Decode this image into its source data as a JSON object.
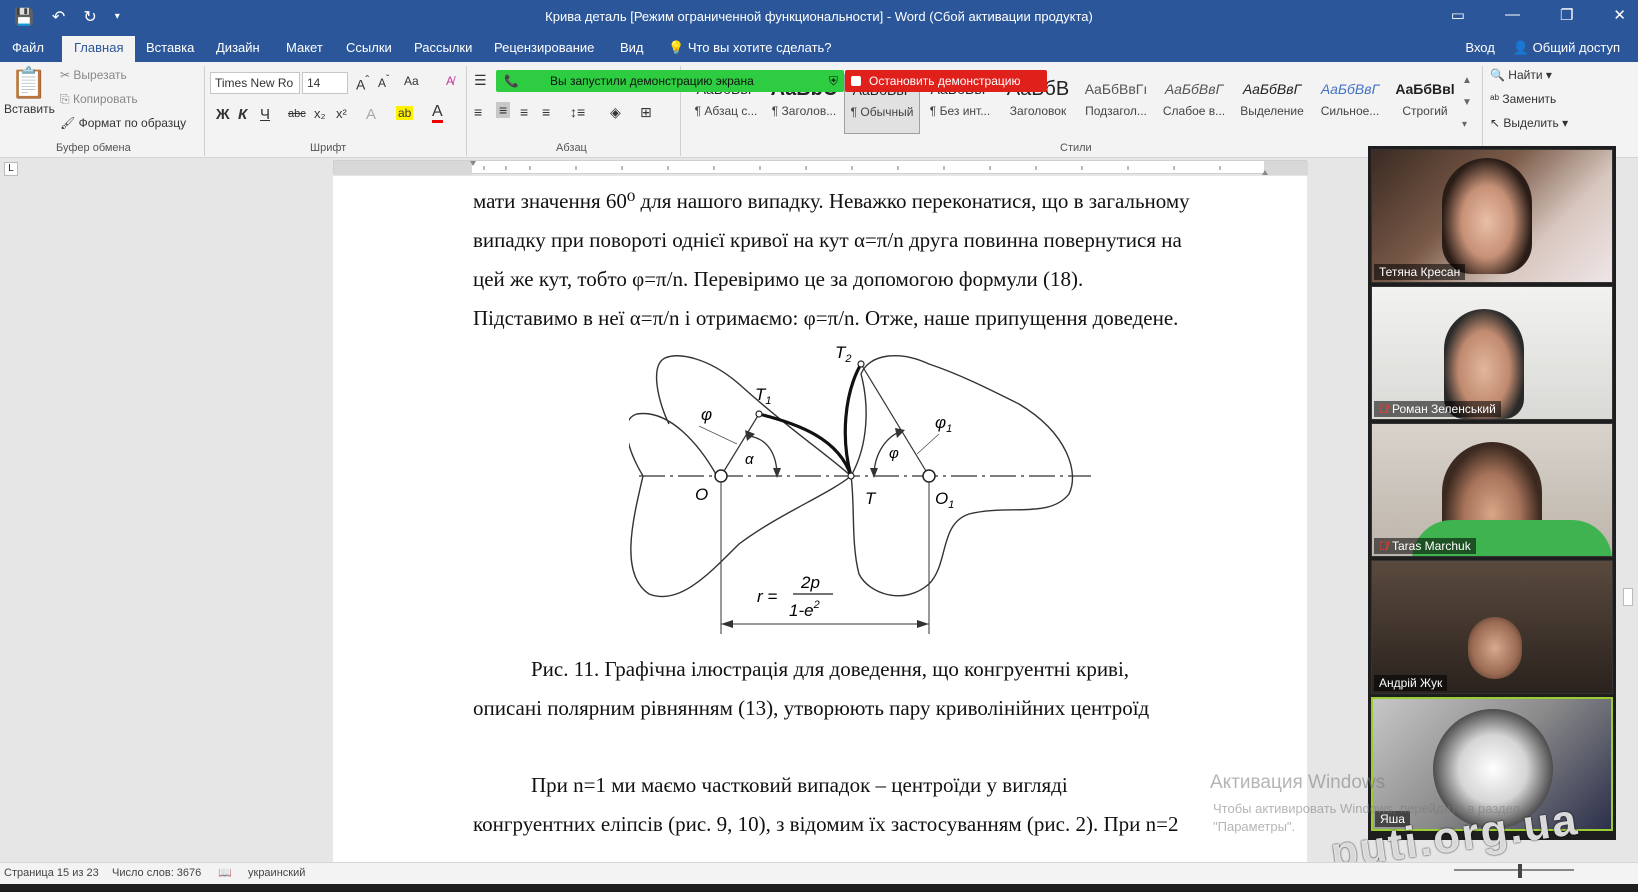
{
  "window": {
    "title": "Крива деталь [Режим ограниченной функциональности] - Word (Сбой активации продукта)"
  },
  "tabs": [
    "Файл",
    "Главная",
    "Вставка",
    "Дизайн",
    "Макет",
    "Ссылки",
    "Рассылки",
    "Рецензирование",
    "Вид"
  ],
  "tell_me": "Что вы хотите сделать?",
  "account": {
    "login": "Вход",
    "share": "Общий доступ"
  },
  "clipboard": {
    "paste": "Вставить",
    "cut": "Вырезать",
    "copy": "Копировать",
    "format_painter": "Формат по образцу",
    "group": "Буфер обмена"
  },
  "font": {
    "name": "Times New Ro",
    "size": "14",
    "group": "Шрифт",
    "bold": "Ж",
    "italic": "К",
    "underline": "Ч",
    "strike": "abc",
    "sub": "x₂",
    "sup": "x²",
    "aa": "Aa"
  },
  "paragraph": {
    "group": "Абзац"
  },
  "styles": {
    "group": "Стили",
    "items": [
      {
        "preview": "AaБбВвГ",
        "name": "¶ Абзац с..."
      },
      {
        "preview": "AaBbC",
        "name": "¶ Заголов..."
      },
      {
        "preview": "AaБбВвГ",
        "name": "¶ Обычный"
      },
      {
        "preview": "AaБбВвГ",
        "name": "¶ Без инт..."
      },
      {
        "preview": "AaБбВ",
        "name": "Заголовок"
      },
      {
        "preview": "AaБбВвГı",
        "name": "Подзагол..."
      },
      {
        "preview": "AaБбВвГ",
        "name": "Слабое в..."
      },
      {
        "preview": "AaБбВвГ",
        "name": "Выделение"
      },
      {
        "preview": "AaБбВвГ",
        "name": "Сильное..."
      },
      {
        "preview": "AaБбВвl",
        "name": "Строгий"
      }
    ]
  },
  "editing": {
    "find": "Найти",
    "replace": "Заменить",
    "select": "Выделить"
  },
  "screen_share": {
    "status": "Вы запустили демонстрацию экрана",
    "stop": "Остановить демонстрацию"
  },
  "document": {
    "lines": [
      "мати значення 60⁰ для нашого випадку. Неважко переконатися, що в загальному",
      "випадку при повороті однієї кривої на кут α=π/n друга повинна повернутися на",
      "цей же кут, тобто φ=π/n. Перевіримо це за допомогою формули (18).",
      "Підставимо в неї α=π/n і отримаємо: φ=π/n. Отже, наше припущення доведене."
    ],
    "figure_labels": {
      "T1": "T",
      "T1_sub": "1",
      "T2": "T",
      "T2_sub": "2",
      "phi": "φ",
      "phi1": "φ",
      "phi1_sub": "1",
      "alpha": "α",
      "phi_arc": "φ",
      "O": "O",
      "T": "T",
      "O1": "O",
      "O1_sub": "1",
      "r": "r =",
      "num": "2p",
      "den": "1-e",
      "den_sup": "2"
    },
    "caption_line1": "Рис. 11. Графічна ілюстрація для доведення, що конгруентні криві,",
    "caption_line2": "описані полярним рівнянням (13), утворюють пару криволінійних центроїд",
    "para2_line1": "При n=1 ми маємо частковий випадок – центроїди у вигляді",
    "para2_line2": "конгруентних еліпсів (рис. 9, 10), з відомим їх застосуванням (рис. 2). При n=2"
  },
  "participants": [
    {
      "name": "Тетяна Кресан",
      "muted": false
    },
    {
      "name": "Роман Зеленський",
      "muted": true
    },
    {
      "name": "Taras Marchuk",
      "muted": true
    },
    {
      "name": "Андрій Жук",
      "muted": false
    },
    {
      "name": "Яша",
      "muted": false
    }
  ],
  "status": {
    "page": "Страница 15 из 23",
    "words": "Число слов: 3676",
    "lang": "украинский"
  },
  "activation": {
    "title": "Активация Windows",
    "line1": "Чтобы активировать Windows, перейдите в раздел",
    "line2": "\"Параметры\"."
  },
  "site_watermark": "puti.org.ua",
  "colors": {
    "word_blue": "#2b579a",
    "share_green": "#2ecc40",
    "stop_red": "#e0201b"
  }
}
